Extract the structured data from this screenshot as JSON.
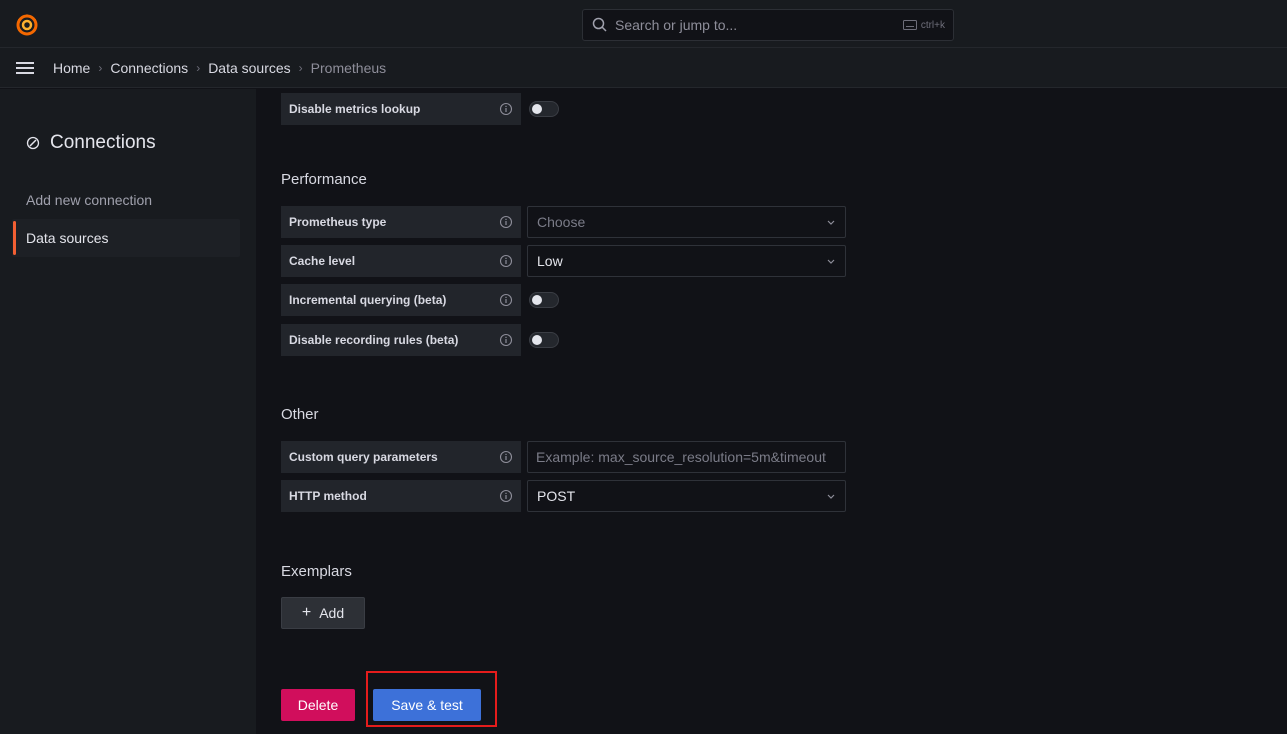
{
  "search": {
    "placeholder": "Search or jump to...",
    "shortcut": "ctrl+k"
  },
  "breadcrumb": [
    "Home",
    "Connections",
    "Data sources",
    "Prometheus"
  ],
  "sidebar": {
    "title": "Connections",
    "items": [
      {
        "label": "Add new connection",
        "active": false
      },
      {
        "label": "Data sources",
        "active": true
      }
    ]
  },
  "top_row": {
    "label": "Disable metrics lookup",
    "enabled": false
  },
  "performance": {
    "title": "Performance",
    "prometheus_type": {
      "label": "Prometheus type",
      "placeholder": "Choose"
    },
    "cache_level": {
      "label": "Cache level",
      "value": "Low"
    },
    "incremental_querying": {
      "label": "Incremental querying (beta)",
      "enabled": false
    },
    "disable_recording_rules": {
      "label": "Disable recording rules (beta)",
      "enabled": false
    }
  },
  "other": {
    "title": "Other",
    "custom_query": {
      "label": "Custom query parameters",
      "placeholder": "Example: max_source_resolution=5m&timeout"
    },
    "http_method": {
      "label": "HTTP method",
      "value": "POST"
    }
  },
  "exemplars": {
    "title": "Exemplars",
    "add_label": "Add"
  },
  "actions": {
    "delete_label": "Delete",
    "save_label": "Save & test"
  },
  "colors": {
    "accent": "#f25f33",
    "primary": "#3d71d9",
    "destructive": "#d10e5c",
    "highlight": "#e51c1c"
  }
}
